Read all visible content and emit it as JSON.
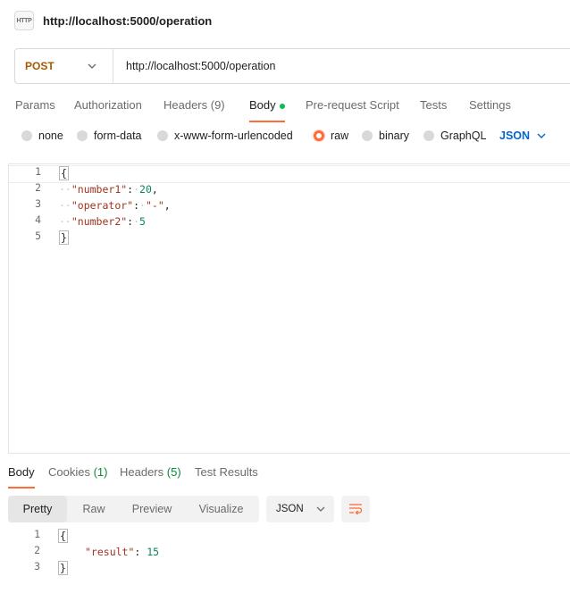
{
  "request": {
    "icon_text": "HTTP",
    "title": "http://localhost:5000/operation",
    "method": "POST",
    "url": "http://localhost:5000/operation"
  },
  "tabs": [
    {
      "label": "Params"
    },
    {
      "label": "Authorization"
    },
    {
      "label": "Headers (9)"
    },
    {
      "label": "Body"
    },
    {
      "label": "Pre-request Script"
    },
    {
      "label": "Tests"
    },
    {
      "label": "Settings"
    }
  ],
  "body_types": [
    {
      "label": "none"
    },
    {
      "label": "form-data"
    },
    {
      "label": "x-www-form-urlencoded"
    },
    {
      "label": "raw"
    },
    {
      "label": "binary"
    },
    {
      "label": "GraphQL"
    }
  ],
  "body_format": "JSON",
  "editor": {
    "line_numbers": [
      "1",
      "2",
      "3",
      "4",
      "5"
    ],
    "lines": {
      "l1": "{",
      "l2_key": "\"number1\"",
      "l2_val": "20",
      "l3_key": "\"operator\"",
      "l3_val": "\"-\"",
      "l4_key": "\"number2\"",
      "l4_val": "5",
      "l5": "}"
    }
  },
  "response": {
    "tabs": {
      "body": "Body",
      "cookies": "Cookies",
      "cookies_count": "(1)",
      "headers": "Headers",
      "headers_count": "(5)",
      "tests": "Test Results"
    },
    "views": [
      "Pretty",
      "Raw",
      "Preview",
      "Visualize"
    ],
    "format": "JSON",
    "line_numbers": [
      "1",
      "2",
      "3"
    ],
    "lines": {
      "l1": "{",
      "l2_key": "\"result\"",
      "l2_val": "15",
      "l3": "}"
    }
  },
  "colors": {
    "accent": "#ff6c37",
    "method": "#a55b00",
    "link": "#0265d2",
    "success_dot": "#0cbb52"
  }
}
